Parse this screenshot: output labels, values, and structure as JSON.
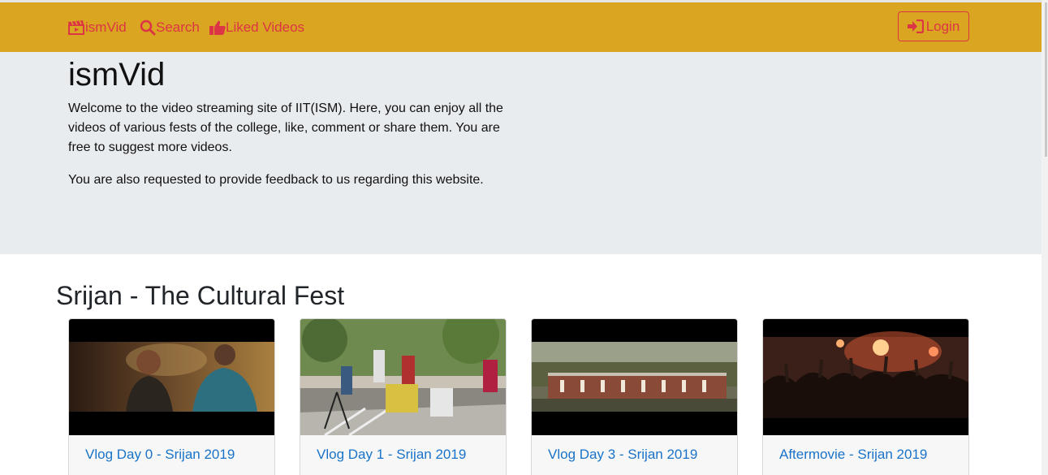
{
  "nav": {
    "brand": "ismVid",
    "search": "Search",
    "liked": "Liked Videos",
    "login": "Login"
  },
  "jumbotron": {
    "title": "ismVid",
    "paragraph1": "Welcome to the video streaming site of IIT(ISM). Here, you can enjoy all the videos of various fests of the college, like, comment or share them. You are free to suggest more videos.",
    "paragraph2": "You are also requested to provide feedback to us regarding this website."
  },
  "section": {
    "title": "Srijan - The Cultural Fest"
  },
  "videos": [
    {
      "title": "Vlog Day 0 - Srijan 2019"
    },
    {
      "title": "Vlog Day 1 - Srijan 2019"
    },
    {
      "title": "Vlog Day 3 - Srijan 2019"
    },
    {
      "title": "Aftermovie - Srijan 2019"
    }
  ],
  "colors": {
    "navbar": "#daa520",
    "accent": "#dc3545",
    "jumbotron": "#e9ecef",
    "link": "#1a73c8"
  }
}
